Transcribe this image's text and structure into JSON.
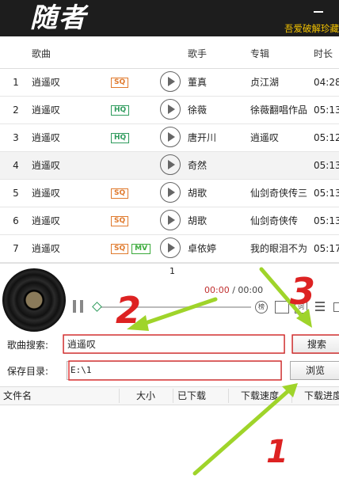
{
  "titlebar": {
    "logo": "随者",
    "slogan": "吾爱破解珍藏"
  },
  "list": {
    "headers": {
      "song": "歌曲",
      "artist": "歌手",
      "album": "专辑",
      "duration": "时长"
    },
    "rows": [
      {
        "num": "1",
        "song": "逍遥叹",
        "tags": [
          "SQ"
        ],
        "artist": "董真",
        "album": "贞江湖",
        "time": "04:28"
      },
      {
        "num": "2",
        "song": "逍遥叹",
        "tags": [
          "HQ"
        ],
        "artist": "徐薇",
        "album": "徐薇翻唱作品",
        "time": "05:13"
      },
      {
        "num": "3",
        "song": "逍遥叹",
        "tags": [
          "HQ"
        ],
        "artist": "唐开川",
        "album": "逍遥叹",
        "time": "05:12"
      },
      {
        "num": "4",
        "song": "逍遥叹",
        "tags": [],
        "artist": "奇然",
        "album": "",
        "time": "05:13"
      },
      {
        "num": "5",
        "song": "逍遥叹",
        "tags": [
          "SQ"
        ],
        "artist": "胡歌",
        "album": "仙剑奇侠传三",
        "time": "05:13"
      },
      {
        "num": "6",
        "song": "逍遥叹",
        "tags": [
          "SQ"
        ],
        "artist": "胡歌",
        "album": "仙剑奇侠传",
        "time": "05:13"
      },
      {
        "num": "7",
        "song": "逍遥叹",
        "tags": [
          "SQ",
          "MV"
        ],
        "artist": "卓依婷",
        "album": "我的眼泪不为",
        "time": "05:17"
      }
    ],
    "page": "1"
  },
  "player": {
    "current_time": "00:00",
    "separator": " / ",
    "total_time": "00:00",
    "icon_rank": "榜",
    "icon_lyric": "词"
  },
  "search": {
    "label": "歌曲搜索:",
    "value": "逍遥叹",
    "button": "搜索"
  },
  "save": {
    "label": "保存目录:",
    "value": "E:\\1",
    "button": "浏览"
  },
  "downloads": {
    "headers": {
      "file": "文件名",
      "size": "大小",
      "downloaded": "已下载",
      "speed": "下载速度",
      "progress": "下载进度"
    }
  },
  "annotations": {
    "mark1": "1",
    "mark2": "2",
    "mark3": "3"
  },
  "colors": {
    "accent_red": "#dd2222",
    "arrow_green": "#9fd42a",
    "slogan": "#f5c400"
  }
}
